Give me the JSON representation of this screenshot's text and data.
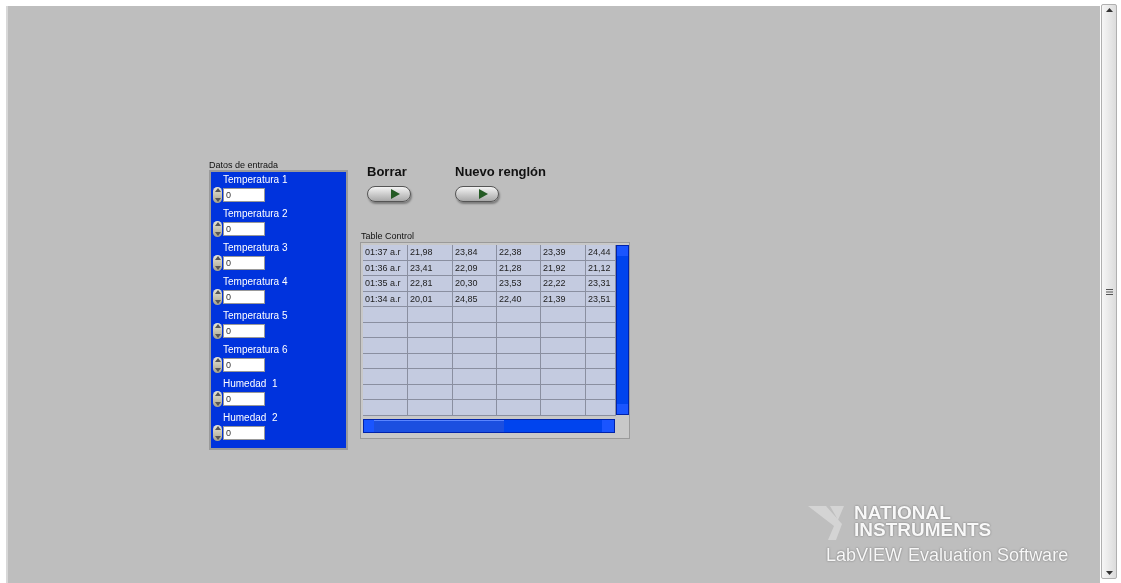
{
  "inputs": {
    "label": "Datos de entrada",
    "fields": [
      {
        "label": "Temperatura 1",
        "value": "0"
      },
      {
        "label": "Temperatura 2",
        "value": "0"
      },
      {
        "label": "Temperatura 3",
        "value": "0"
      },
      {
        "label": "Temperatura 4",
        "value": "0"
      },
      {
        "label": "Temperatura 5",
        "value": "0"
      },
      {
        "label": "Temperatura 6",
        "value": "0"
      },
      {
        "label": "Humedad  1",
        "value": "0"
      },
      {
        "label": "Humedad  2",
        "value": "0"
      }
    ]
  },
  "buttons": [
    {
      "label": "Borrar",
      "on": false
    },
    {
      "label": "Nuevo renglón",
      "on": false
    }
  ],
  "table": {
    "label": "Table Control",
    "rows": [
      [
        "01:37 a.r",
        "21,98",
        "23,84",
        "22,38",
        "23,39",
        "24,44"
      ],
      [
        "01:36 a.r",
        "23,41",
        "22,09",
        "21,28",
        "21,92",
        "21,12"
      ],
      [
        "01:35 a.r",
        "22,81",
        "20,30",
        "23,53",
        "22,22",
        "23,31"
      ],
      [
        "01:34 a.r",
        "20,01",
        "24,85",
        "22,40",
        "21,39",
        "23,51"
      ]
    ]
  },
  "watermark": {
    "brand_line1": "NATIONAL",
    "brand_line2": "INSTRUMENTS",
    "product": "LabVIEW",
    "edition": "Evaluation Software"
  }
}
